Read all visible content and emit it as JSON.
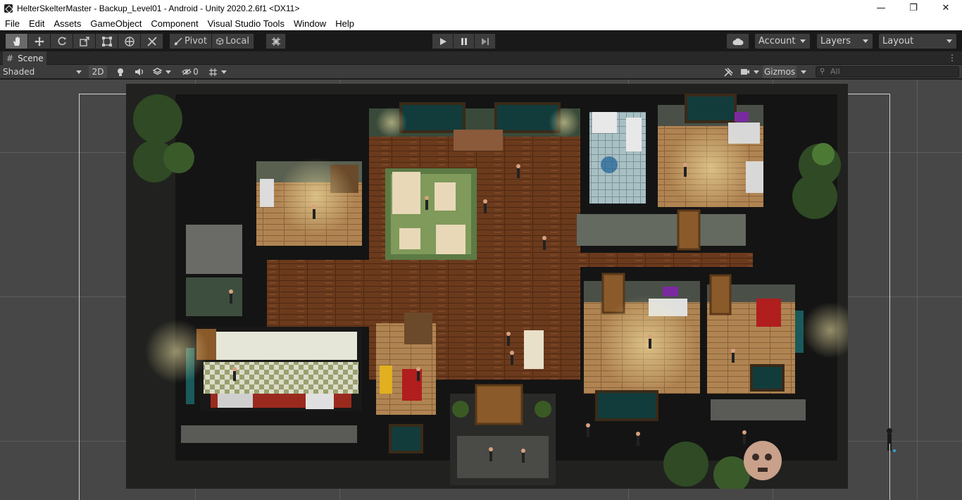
{
  "window": {
    "title": "HelterSkelterMaster - Backup_Level01 - Android - Unity 2020.2.6f1 <DX11>",
    "controls": {
      "minimize": "—",
      "maximize": "❐",
      "close": "✕"
    }
  },
  "menu": [
    "File",
    "Edit",
    "Assets",
    "GameObject",
    "Component",
    "Visual Studio Tools",
    "Window",
    "Help"
  ],
  "toolbar": {
    "tools": [
      "hand-tool",
      "move-tool",
      "rotate-tool",
      "scale-tool",
      "rect-tool",
      "transform-tool",
      "custom-tool"
    ],
    "active_tool": "hand-tool",
    "pivot_label": "Pivot",
    "local_label": "Local",
    "account_label": "Account",
    "layers_label": "Layers",
    "layout_label": "Layout"
  },
  "scene_tab": {
    "label": "Scene"
  },
  "scene_toolbar": {
    "draw_mode": "Shaded",
    "mode_2d": "2D",
    "hidden_count": "0",
    "gizmos_label": "Gizmos",
    "search_placeholder": "All"
  },
  "colors": {
    "editor_bg": "#191919",
    "panel": "#3c3c3c",
    "scene_bg": "#474747",
    "floor_wood": "#6b3d1e",
    "wall_dark": "#1c1c1c"
  }
}
